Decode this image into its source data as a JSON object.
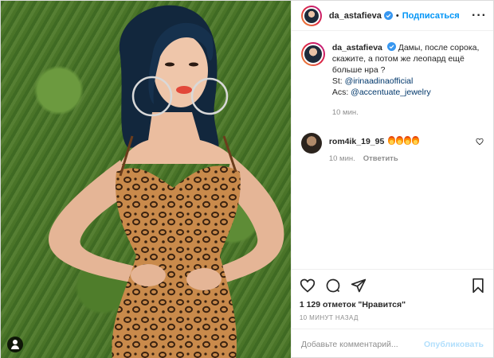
{
  "header": {
    "username": "da_astafieva",
    "separator": "•",
    "follow_label": "Подписаться",
    "more_label": "···"
  },
  "caption": {
    "username": "da_astafieva",
    "text_line1": "Дамы, после сорока, скажите, а потом же леопард ещё больше нра ?",
    "st_prefix": "St: ",
    "st_link": "@irinaadinaofficial",
    "acs_prefix": "Acs: ",
    "acs_link": "@accentuate_jewelry",
    "time": "10 мин."
  },
  "comments": [
    {
      "username": "rom4ik_19_95",
      "emoji_count": 4,
      "time": "10 мин.",
      "reply_label": "Ответить"
    }
  ],
  "likes": "1 129 отметок \"Нравится\"",
  "post_time": "10 МИНУТ НАЗАД",
  "comment_box": {
    "placeholder": "Добавьте комментарий...",
    "publish_label": "Опубликовать"
  },
  "colors": {
    "link_blue": "#0095f6",
    "publish_disabled": "#b2dffc",
    "verified": "#3897f0"
  }
}
